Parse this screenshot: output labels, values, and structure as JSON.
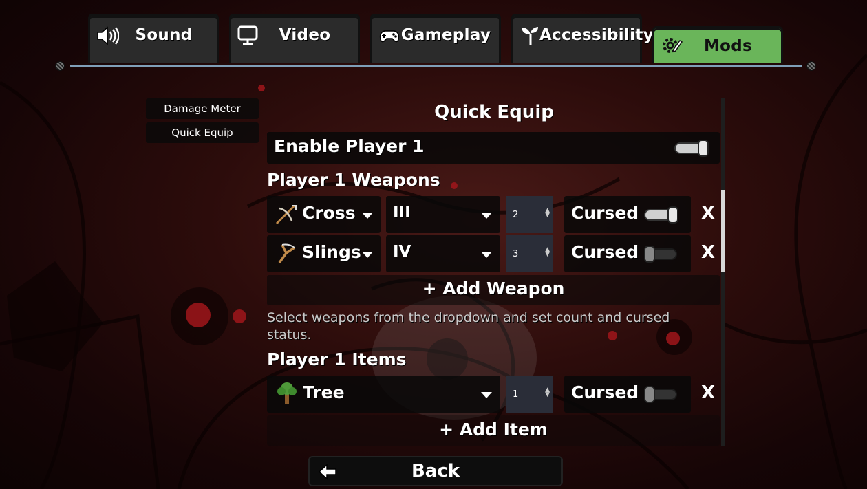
{
  "tabs": [
    {
      "label": "Sound",
      "icon": "speaker-icon"
    },
    {
      "label": "Video",
      "icon": "monitor-icon"
    },
    {
      "label": "Gameplay",
      "icon": "gamepad-icon"
    },
    {
      "label": "Accessibility",
      "icon": "sprout-icon"
    },
    {
      "label": "Mods",
      "icon": "gear-pencil-icon",
      "active": true
    }
  ],
  "sidebar": {
    "items": [
      {
        "label": "Damage Meter"
      },
      {
        "label": "Quick Equip",
        "selected": true
      }
    ]
  },
  "panel": {
    "title": "Quick Equip",
    "enable_player": {
      "label": "Enable Player 1",
      "enabled": true
    },
    "weapons_heading": "Player 1 Weapons",
    "weapons": [
      {
        "name": "Cross",
        "icon": "crossbow-icon",
        "level": "III",
        "count": "2",
        "cursed_label": "Cursed",
        "cursed": true,
        "remove": "X"
      },
      {
        "name": "Slings",
        "icon": "slingshot-icon",
        "level": "IV",
        "count": "3",
        "cursed_label": "Cursed",
        "cursed": false,
        "remove": "X"
      }
    ],
    "add_weapon": "+ Add Weapon",
    "help_text": "Select weapons from the dropdown and set count and cursed status.",
    "items_heading": "Player 1 Items",
    "items": [
      {
        "name": "Tree",
        "icon": "tree-icon",
        "count": "1",
        "cursed_label": "Cursed",
        "cursed": false,
        "remove": "X"
      }
    ],
    "add_item": "+ Add Item"
  },
  "footer": {
    "back_label": "Back",
    "back_icon": "arrow-left-icon"
  },
  "colors": {
    "active_tab": "#6ab55a",
    "rail": "#7f9fb8",
    "background": "#2c0c0b"
  }
}
